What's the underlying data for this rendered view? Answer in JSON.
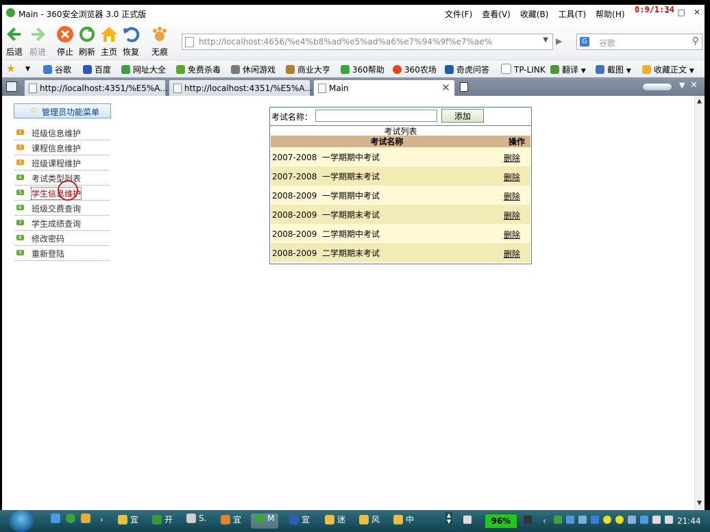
{
  "window": {
    "title": "Main - 360安全浏览器 3.0 正式版",
    "menus": [
      "文件(F)",
      "查看(V)",
      "收藏(B)",
      "工具(T)",
      "帮助(H)"
    ],
    "timer": "0:9/1:34"
  },
  "nav": {
    "back": "后退",
    "forward": "前进",
    "stop": "停止",
    "refresh": "刷新",
    "home": "主页",
    "restore": "恢复",
    "private": "无痕",
    "url": "http://localhost:4656/%e4%b8%ad%e5%ad%a6%e7%94%9f%e7%ae%",
    "search_placeholder": "谷歌"
  },
  "favorites": [
    "谷歌",
    "百度",
    "网址大全",
    "免费杀毒",
    "休闲游戏",
    "商业大亨",
    "360帮助",
    "360农场",
    "奇虎问答",
    "TP-LINK",
    "翻译",
    "截图",
    "收藏正文"
  ],
  "tabs": [
    {
      "label": "http://localhost:4351/%E5%A..."
    },
    {
      "label": "http://localhost:4351/%E5%A..."
    },
    {
      "label": "Main"
    }
  ],
  "sidebar": {
    "title": "管理员功能菜单",
    "items": [
      {
        "num": "1",
        "label": "班级信息维护"
      },
      {
        "num": "2",
        "label": "课程信息维护"
      },
      {
        "num": "3",
        "label": "班级课程维护"
      },
      {
        "num": "4",
        "label": "考试类型列表"
      },
      {
        "num": "5",
        "label": "学生信息维护"
      },
      {
        "num": "6",
        "label": "班级交费查询"
      },
      {
        "num": "7",
        "label": "学生成绩查询"
      },
      {
        "num": "8",
        "label": "修改密码"
      },
      {
        "num": "9",
        "label": "重新登陆"
      }
    ]
  },
  "exam": {
    "name_label": "考试名称：",
    "name_value": "",
    "add_label": "添加",
    "caption": "考试列表",
    "columns": [
      "考试名称",
      "操作"
    ],
    "rows": [
      {
        "name": "2007-2008  一学期期中考试",
        "action": "删除"
      },
      {
        "name": "2007-2008  一学期期末考试",
        "action": "删除"
      },
      {
        "name": "2008-2009  一学期期中考试",
        "action": "删除"
      },
      {
        "name": "2008-2009  一学期期末考试",
        "action": "删除"
      },
      {
        "name": "2008-2009  二学期期中考试",
        "action": "删除"
      },
      {
        "name": "2008-2009  二学期期末考试",
        "action": "删除"
      }
    ]
  },
  "taskbar": {
    "items": [
      "宜",
      "开",
      "S.",
      "宜",
      "M",
      "宜",
      "迷",
      "风",
      "中"
    ],
    "battery": "96%",
    "clock": "21:44"
  }
}
